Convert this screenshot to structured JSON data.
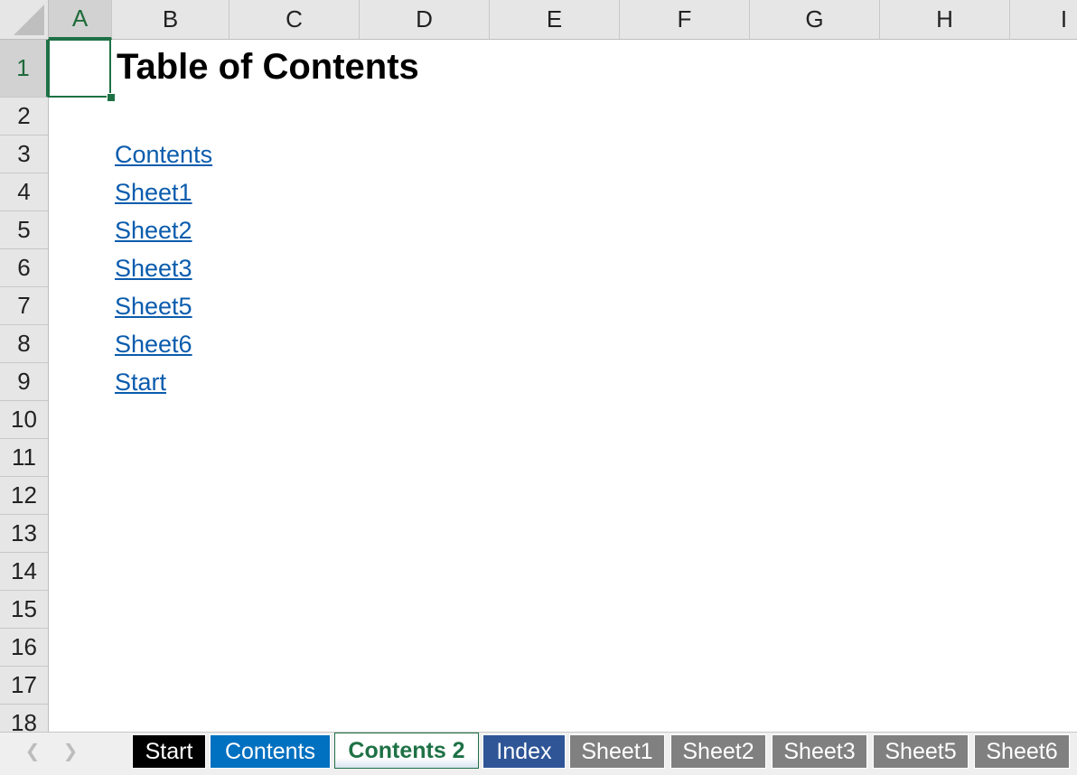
{
  "columns": [
    "A",
    "B",
    "C",
    "D",
    "E",
    "F",
    "G",
    "H",
    "I"
  ],
  "rows": [
    "1",
    "2",
    "3",
    "4",
    "5",
    "6",
    "7",
    "8",
    "9",
    "10",
    "11",
    "12",
    "13",
    "14",
    "15",
    "16",
    "17",
    "18"
  ],
  "selected_cell": {
    "column": "A",
    "row": "1"
  },
  "title": "Table of Contents",
  "links": [
    "Contents",
    "Sheet1",
    "Sheet2",
    "Sheet3",
    "Sheet5",
    "Sheet6",
    "Start"
  ],
  "tabs": [
    {
      "label": "Start",
      "bg": "#000000",
      "color": "#ffffff"
    },
    {
      "label": "Contents",
      "bg": "#0070c0",
      "color": "#ffffff"
    },
    {
      "label": "Contents 2",
      "bg": "#ffffff",
      "color": "#1e7145",
      "active": true
    },
    {
      "label": "Index",
      "bg": "#2f5597",
      "color": "#ffffff"
    },
    {
      "label": "Sheet1",
      "bg": "#808080",
      "color": "#ffffff"
    },
    {
      "label": "Sheet2",
      "bg": "#808080",
      "color": "#ffffff"
    },
    {
      "label": "Sheet3",
      "bg": "#808080",
      "color": "#ffffff"
    },
    {
      "label": "Sheet5",
      "bg": "#808080",
      "color": "#ffffff"
    },
    {
      "label": "Sheet6",
      "bg": "#808080",
      "color": "#ffffff"
    }
  ],
  "nav_icons": {
    "prev": "chevron-left-icon",
    "next": "chevron-right-icon"
  }
}
